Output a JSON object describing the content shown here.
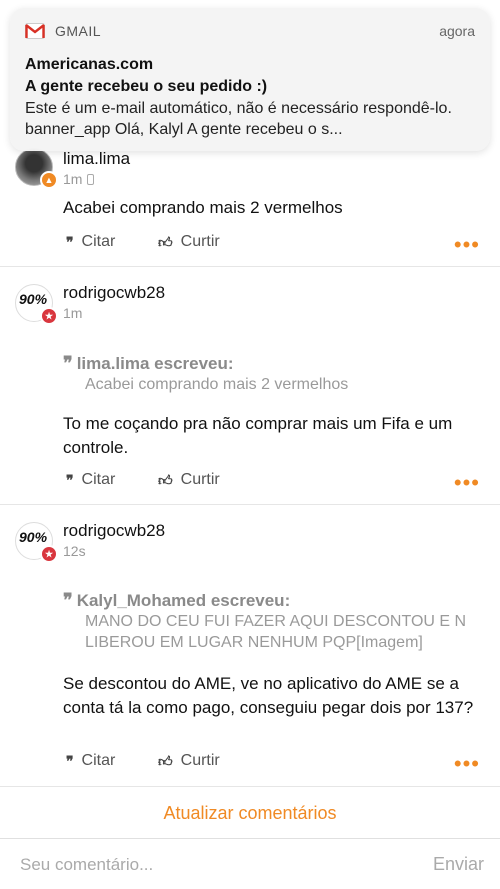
{
  "notification": {
    "app": "GMAIL",
    "time": "agora",
    "from": "Americanas.com",
    "subject": "A gente recebeu o seu pedido :)",
    "body": "Este é um e-mail automático, não é necessário respondê-lo. banner_app Olá, Kalyl A gente recebeu o s..."
  },
  "posts": [
    {
      "username": "lima.lima",
      "time": "1m",
      "content": "Acabei comprando mais 2 vermelhos"
    },
    {
      "username": "rodrigocwb28",
      "time": "1m",
      "avatar_text": "90%",
      "quote_author": "lima.lima escreveu:",
      "quote_text": "Acabei comprando mais 2 vermelhos",
      "content": "To me coçando pra não comprar mais um Fifa e um controle."
    },
    {
      "username": "rodrigocwb28",
      "time": "12s",
      "avatar_text": "90%",
      "quote_author": "Kalyl_Mohamed escreveu:",
      "quote_text": "MANO DO CEU FUI FAZER AQUI DESCONTOU E N LIBEROU EM LUGAR NENHUM PQP[Imagem]",
      "content": "Se descontou do AME, ve no aplicativo do AME se a conta tá la como pago, conseguiu pegar dois por 137?"
    }
  ],
  "actions": {
    "quote_label": "Citar",
    "like_label": "Curtir",
    "more_label": "•••"
  },
  "footer": {
    "refresh_label": "Atualizar comentários",
    "comment_placeholder": "Seu comentário...",
    "send_label": "Enviar"
  },
  "colors": {
    "accent": "#f08a24",
    "muted": "#9a9a9a"
  }
}
